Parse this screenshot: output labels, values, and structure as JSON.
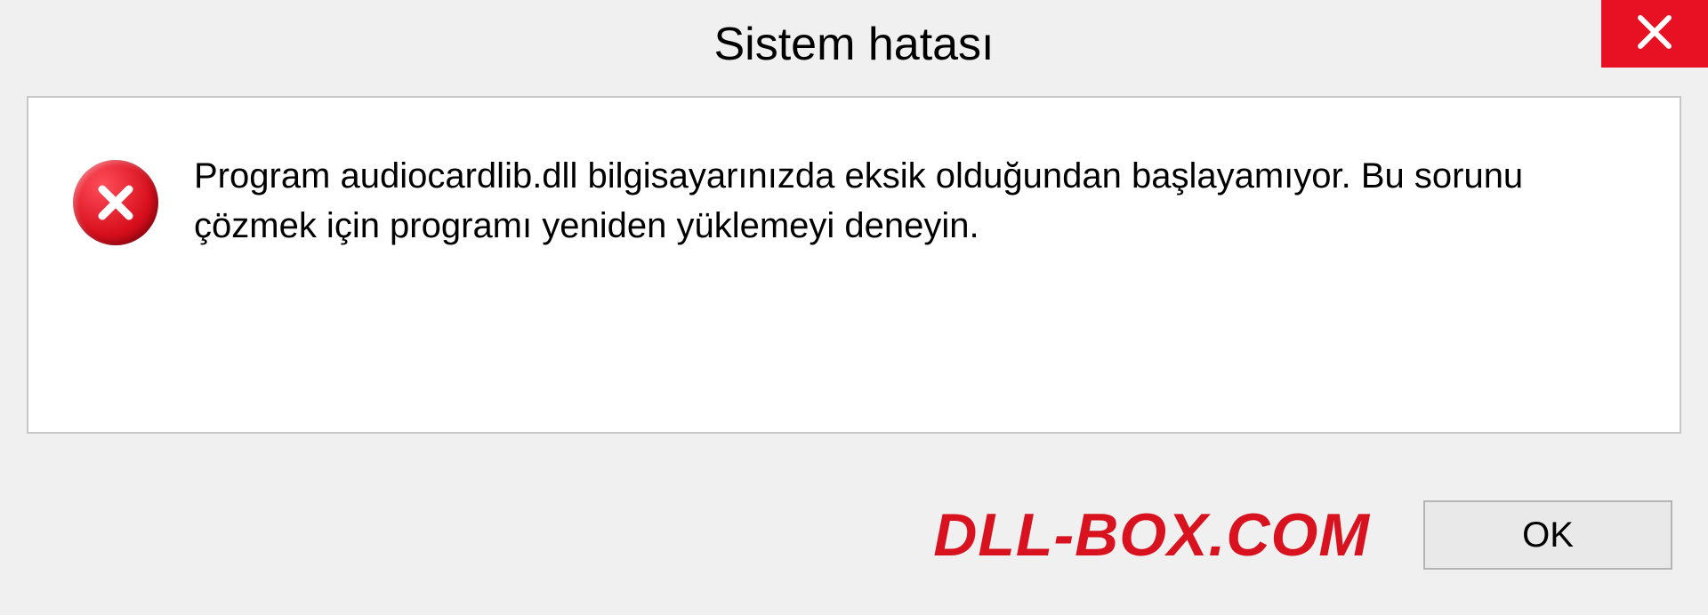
{
  "dialog": {
    "title": "Sistem hatası",
    "message": "Program audiocardlib.dll bilgisayarınızda eksik olduğundan başlayamıyor. Bu sorunu çözmek için programı yeniden yüklemeyi deneyin.",
    "ok_label": "OK"
  },
  "watermark": "DLL-BOX.COM",
  "colors": {
    "close_button": "#e81123",
    "watermark": "#d8121e"
  }
}
